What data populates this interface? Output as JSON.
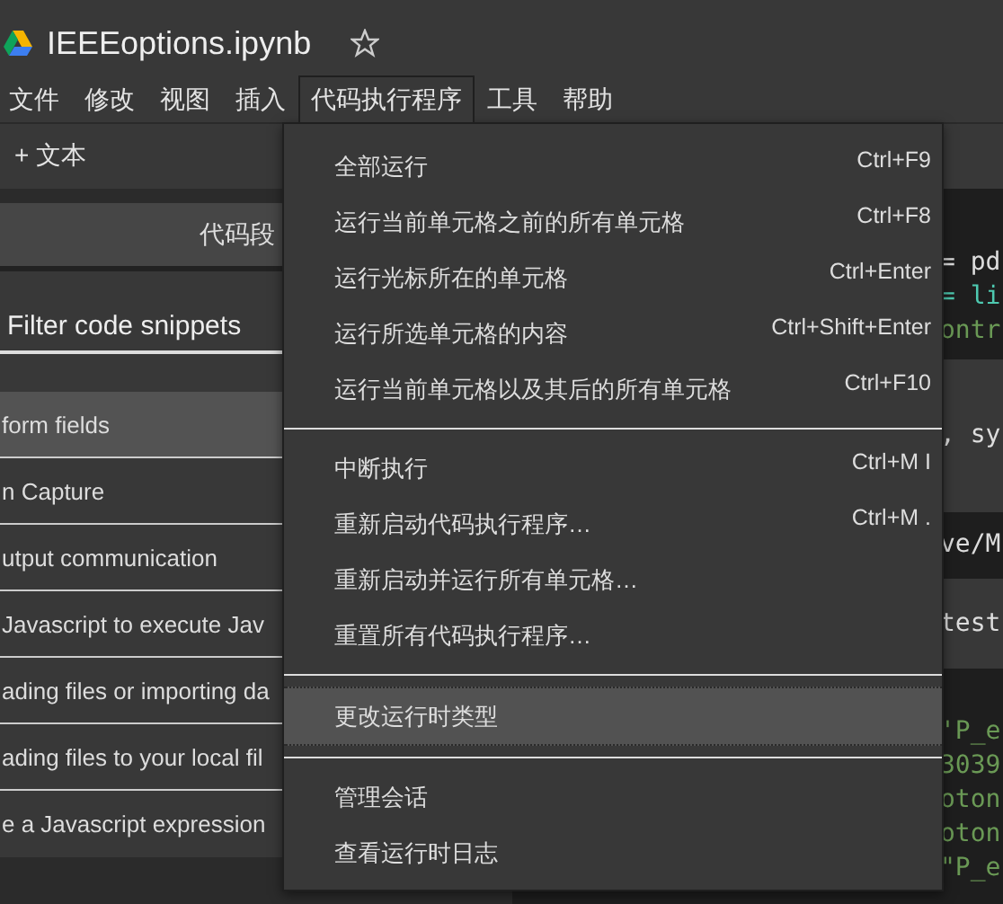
{
  "notebook": {
    "title": "IEEEoptions.ipynb",
    "starred": false
  },
  "menu_bar": [
    {
      "label": "文件",
      "selected": false
    },
    {
      "label": "修改",
      "selected": false
    },
    {
      "label": "视图",
      "selected": false
    },
    {
      "label": "插入",
      "selected": false
    },
    {
      "label": "代码执行程序",
      "selected": true
    },
    {
      "label": "工具",
      "selected": false
    },
    {
      "label": "帮助",
      "selected": false
    }
  ],
  "toolbar": {
    "add_text": "+ 文本"
  },
  "sidebar": {
    "tabs": [
      {
        "label": "代码段",
        "selected": true
      }
    ],
    "filter": {
      "placeholder": "Filter code snippets"
    },
    "snippets": [
      {
        "label": "form fields",
        "selected": true
      },
      {
        "label": "n Capture",
        "selected": false
      },
      {
        "label": "utput communication",
        "selected": false
      },
      {
        "label": "Javascript to execute Jav",
        "selected": false
      },
      {
        "label": "ading files or importing da",
        "selected": false
      },
      {
        "label": "ading files to your local fil",
        "selected": false
      },
      {
        "label": "e a Javascript expression",
        "selected": false
      }
    ]
  },
  "dropdown": {
    "groups": [
      [
        {
          "label": "全部运行",
          "shortcut": "Ctrl+F9",
          "selected": false
        },
        {
          "label": "运行当前单元格之前的所有单元格",
          "shortcut": "Ctrl+F8",
          "selected": false
        },
        {
          "label": "运行光标所在的单元格",
          "shortcut": "Ctrl+Enter",
          "selected": false
        },
        {
          "label": "运行所选单元格的内容",
          "shortcut": "Ctrl+Shift+Enter",
          "selected": false
        },
        {
          "label": "运行当前单元格以及其后的所有单元格",
          "shortcut": "Ctrl+F10",
          "selected": false
        }
      ],
      [
        {
          "label": "中断执行",
          "shortcut": "Ctrl+M I",
          "selected": false
        },
        {
          "label": "重新启动代码执行程序…",
          "shortcut": "Ctrl+M .",
          "selected": false
        },
        {
          "label": "重新启动并运行所有单元格…",
          "selected": false
        },
        {
          "label": "重置所有代码执行程序…",
          "selected": false
        }
      ],
      [
        {
          "label": "更改运行时类型",
          "selected": true
        }
      ],
      [
        {
          "label": "管理会话",
          "selected": false
        },
        {
          "label": "查看运行时日志",
          "selected": false
        }
      ]
    ]
  },
  "code": {
    "cells": [
      {
        "kind": "toolbar"
      },
      {
        "kind": "code",
        "lines": [
          {
            "text": "= pd",
            "kind": "plain"
          },
          {
            "text": "= li",
            "kind": "builtin"
          },
          {
            "text": "ontr",
            "kind": "string"
          }
        ]
      },
      {
        "kind": "output",
        "lines": [
          {
            "text": ", sy",
            "kind": "plain"
          }
        ]
      },
      {
        "kind": "code",
        "lines": [
          {
            "text": "ve/M",
            "kind": "plain"
          }
        ]
      },
      {
        "kind": "output",
        "lines": [
          {
            "text": "test",
            "kind": "plain"
          }
        ]
      },
      {
        "kind": "code",
        "lines": [
          {
            "text": "'P_e",
            "kind": "string"
          },
          {
            "text": "3039",
            "kind": "string"
          },
          {
            "text": "oton",
            "kind": "string"
          },
          {
            "text": "oton",
            "kind": "string"
          },
          {
            "text": "\"P_e",
            "kind": "string"
          }
        ]
      }
    ]
  }
}
